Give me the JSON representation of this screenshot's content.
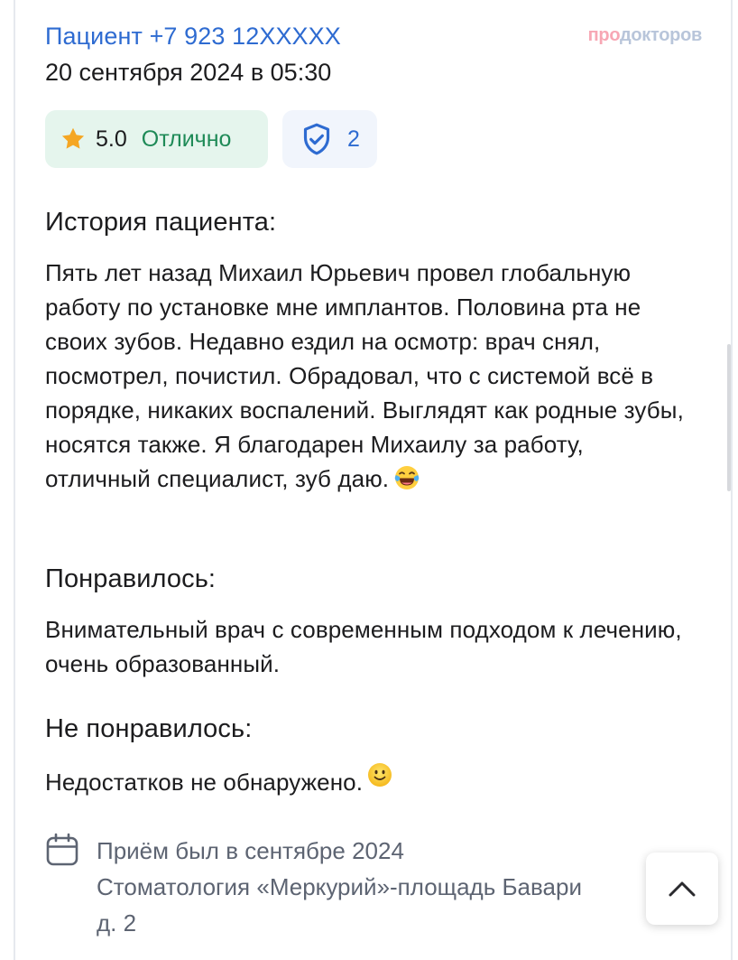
{
  "review": {
    "author": "Пациент +7 923 12XXXXX",
    "brand_part1": "про",
    "brand_part2": "докторов",
    "date": "20 сентября 2024 в 05:30",
    "rating": {
      "score": "5.0",
      "label": "Отлично",
      "star_icon": "star-icon",
      "accent_color": "#1e8a57"
    },
    "verification": {
      "icon": "shield-check-icon",
      "count": "2"
    },
    "history": {
      "title": "История пациента:",
      "text": "Пять лет назад Михаил Юрьевич провел глобальную работу по установке мне имплантов. Половина рта не своих зубов. Недавно ездил на осмотр: врач снял, посмотрел, почистил. Обрадовал, что с системой всё в порядке, никаких воспалений. Выглядят как родные зубы, носятся также. Я благодарен Михаилу за работу, отличный специалист, зуб даю.",
      "emoji": "laughing-tears-emoji"
    },
    "liked": {
      "title": "Понравилось:",
      "text": "Внимательный врач с современным подходом к лечению, очень образованный."
    },
    "disliked": {
      "title": "Не понравилось:",
      "text": "Недостатков не обнаружено.",
      "emoji": "smile-emoji"
    },
    "visit": {
      "icon": "calendar-icon",
      "line1": "Приём был в сентябре 2024",
      "line2": "Стоматология «Меркурий»-площадь Бавари",
      "line3": "д. 2"
    }
  },
  "controls": {
    "scroll_up_icon": "chevron-up-icon"
  },
  "colors": {
    "link_blue": "#2e6bd1",
    "rating_bg": "#e5f5ed",
    "verify_bg": "#f1f5fc",
    "muted_text": "#5d6472"
  }
}
